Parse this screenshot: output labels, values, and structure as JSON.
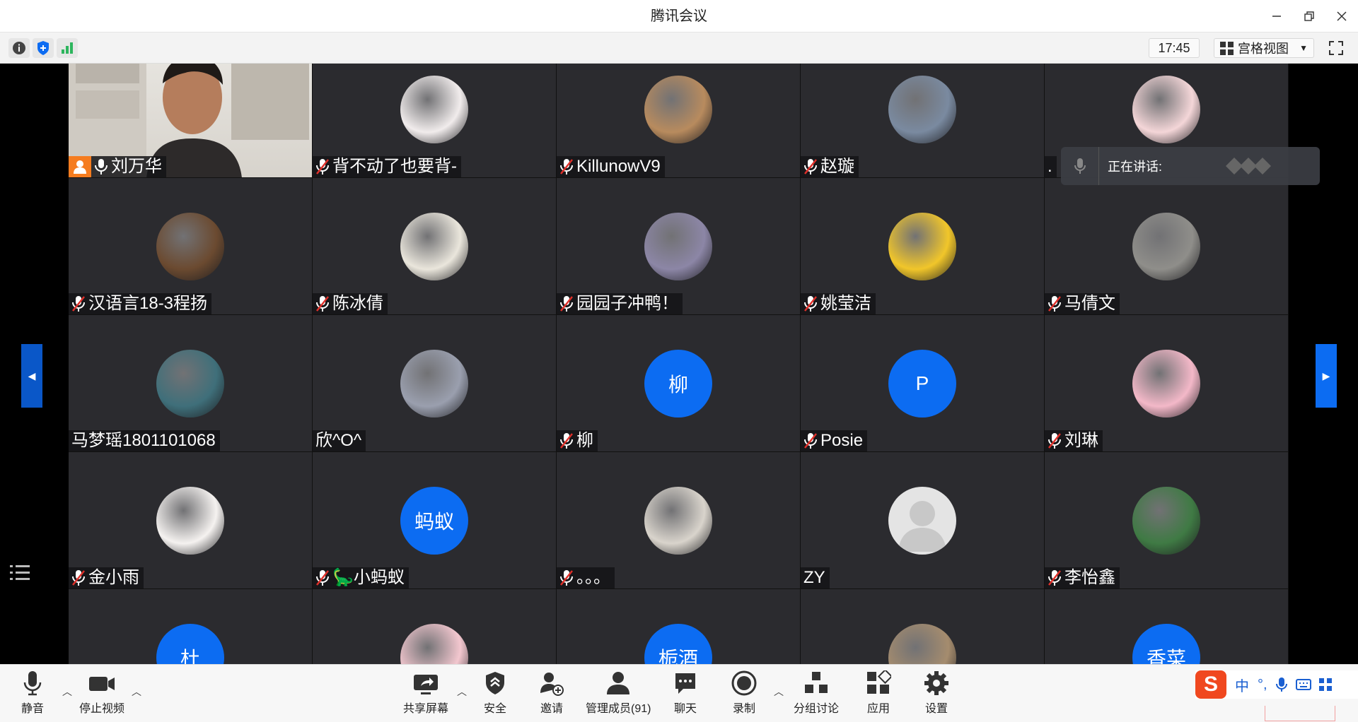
{
  "window": {
    "title": "腾讯会议"
  },
  "topbar": {
    "time": "17:45",
    "view_label": "宫格视图"
  },
  "speaking": {
    "label": "正在讲话:"
  },
  "participants": [
    {
      "name": "刘万华",
      "type": "video",
      "host": true,
      "muted": false
    },
    {
      "name": "背不动了也要背-",
      "type": "photo",
      "color": "#f1ecec",
      "muted": true
    },
    {
      "name": "KillunowV9",
      "type": "photo",
      "color": "#b88b5e",
      "muted": true
    },
    {
      "name": "赵璇",
      "type": "photo",
      "color": "#7a8aa0",
      "muted": true
    },
    {
      "name": ".",
      "type": "photo",
      "color": "#f4d6d8",
      "muted": false
    },
    {
      "name": "汉语言18-3程扬",
      "type": "photo",
      "color": "#6b4a30",
      "muted": true
    },
    {
      "name": "陈冰倩",
      "type": "photo",
      "color": "#eae6dc",
      "muted": true
    },
    {
      "name": "园园子冲鸭！",
      "type": "photo",
      "color": "#8c86a6",
      "muted": true
    },
    {
      "name": "姚莹洁",
      "type": "photo",
      "color": "#f1c62a",
      "muted": true
    },
    {
      "name": "马倩文",
      "type": "photo",
      "color": "#8f8e8a",
      "muted": true
    },
    {
      "name": "马梦瑶1801101068",
      "type": "photo",
      "color": "#3f6f7a",
      "muted": false
    },
    {
      "name": "欣^O^",
      "type": "photo",
      "color": "#9a9fae",
      "muted": false
    },
    {
      "name": "柳",
      "type": "text",
      "initial": "柳",
      "muted": true
    },
    {
      "name": "Posie",
      "type": "text",
      "initial": "P",
      "muted": true
    },
    {
      "name": "刘琳",
      "type": "photo",
      "color": "#f3b8c8",
      "muted": true
    },
    {
      "name": "金小雨",
      "type": "photo",
      "color": "#f5f2f0",
      "muted": true
    },
    {
      "name": "🦕小蚂蚁",
      "type": "text",
      "initial": "蚂蚁",
      "muted": true
    },
    {
      "name": "。。。",
      "type": "photo",
      "color": "#d9d4cc",
      "muted": true
    },
    {
      "name": "ZY",
      "type": "default",
      "muted": false
    },
    {
      "name": "李怡鑫",
      "type": "photo",
      "color": "#3f7a44",
      "muted": true
    },
    {
      "name": "",
      "type": "text",
      "initial": "杜",
      "muted": false
    },
    {
      "name": "",
      "type": "photo",
      "color": "#f3c7cf",
      "muted": false
    },
    {
      "name": "",
      "type": "text",
      "initial": "栀酒",
      "muted": false
    },
    {
      "name": "",
      "type": "photo",
      "color": "#a58c6e",
      "muted": false
    },
    {
      "name": "",
      "type": "text",
      "initial": "香菜",
      "muted": false
    }
  ],
  "toolbar": {
    "mute": "静音",
    "stop_video": "停止视频",
    "share_screen": "共享屏幕",
    "security": "安全",
    "invite": "邀请",
    "manage_members": "管理成员(91)",
    "chat": "聊天",
    "record": "录制",
    "breakout": "分组讨论",
    "apps": "应用",
    "settings": "设置"
  },
  "ime": {
    "lang": "中"
  },
  "colors": {
    "accent": "#0c6cf2",
    "tile_bg": "#2b2b2f",
    "host_badge": "#f57c1f"
  }
}
